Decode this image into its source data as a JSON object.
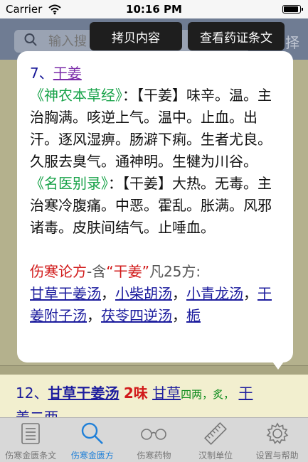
{
  "status_bar": {
    "carrier": "Carrier",
    "time": "10:16 PM",
    "battery_level": 0.95
  },
  "nav": {
    "search_placeholder": "输入搜",
    "select_label": "择"
  },
  "actions": {
    "copy_label": "拷贝内容",
    "view_label": "查看药证条文"
  },
  "popover": {
    "herb_number": "7、",
    "herb_name": "干姜",
    "sources": [
      {
        "source": "《神农本草经》",
        "text": "：【干姜】味辛。温。主治胸满。咳逆上气。温中。止血。出汗。逐风湿痹。肠澼下痢。生者尤良。久服去臭气。通神明。生犍为川谷。"
      },
      {
        "source": "《名医别录》",
        "text": "：【干姜】大热。无毒。主治寒冷腹痛。中恶。霍乱。胀满。风邪诸毒。皮肤间结气。止唾血。"
      }
    ],
    "related": {
      "label": "伤寒论方",
      "prefix": "-含",
      "herb_quoted": "“干姜”",
      "suffix": "凡25方:",
      "formulas": [
        "甘草干姜汤",
        "小柴胡汤",
        "小青龙汤",
        "干姜附子汤",
        "茯苓四逆汤",
        "栀"
      ]
    }
  },
  "row12": {
    "number": "12、",
    "formula": "甘草干姜汤",
    "count": "2味",
    "herb1": "甘草",
    "herb1_dose": "四两，炙，",
    "herb2": "干",
    "line2": "姜二两"
  },
  "tabs": [
    {
      "label": "伤寒金匮条文",
      "icon": "list-icon",
      "active": false
    },
    {
      "label": "伤寒金匮方",
      "icon": "search-icon",
      "active": true
    },
    {
      "label": "伤寒药物",
      "icon": "glasses-icon",
      "active": false
    },
    {
      "label": "汉制单位",
      "icon": "ruler-icon",
      "active": false
    },
    {
      "label": "设置与帮助",
      "icon": "gear-icon",
      "active": false
    }
  ]
}
